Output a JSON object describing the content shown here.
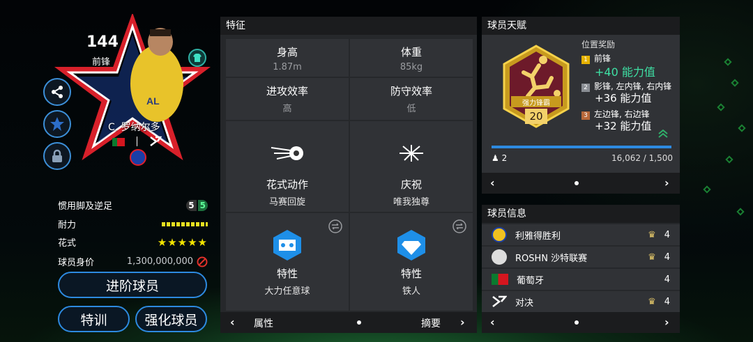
{
  "player": {
    "rating": "144",
    "position": "前锋",
    "name": "C. 罗纳尔多"
  },
  "left_stats": [
    {
      "label": "惯用脚及逆足",
      "value_a": "5",
      "value_b": "5"
    },
    {
      "label": "耐力"
    },
    {
      "label": "花式",
      "stars": "★★★★★"
    },
    {
      "label": "球员身价",
      "value": "1,300,000,000"
    }
  ],
  "buttons": {
    "advance": "进阶球员",
    "train": "特训",
    "enhance": "强化球员"
  },
  "traits": {
    "title": "特征",
    "height_label": "身高",
    "height_value": "1.87m",
    "weight_label": "体重",
    "weight_value": "85kg",
    "atk_label": "进攻效率",
    "atk_value": "高",
    "def_label": "防守效率",
    "def_value": "低",
    "skill_label": "花式动作",
    "skill_value": "马赛回旋",
    "celebration_label": "庆祝",
    "celebration_value": "唯我独尊",
    "trait1_label": "特性",
    "trait1_value": "大力任意球",
    "trait2_label": "特性",
    "trait2_value": "铁人",
    "nav_left": "属性",
    "nav_right": "摘要"
  },
  "talent": {
    "title": "球员天赋",
    "badge_name": "强力锋霸",
    "badge_level": "20",
    "bonus_title": "位置奖励",
    "bonuses": [
      {
        "rank": "1",
        "positions": "前锋",
        "value": "+40 能力值"
      },
      {
        "rank": "2",
        "positions": "影锋, 左内锋, 右内锋",
        "value": "+36 能力值"
      },
      {
        "rank": "3",
        "positions": "左边锋, 右边锋",
        "value": "+32 能力值"
      }
    ],
    "count": "2",
    "progress": "16,062 / 1,500"
  },
  "info": {
    "title": "球员信息",
    "rows": [
      {
        "label": "利雅得胜利",
        "value": "4"
      },
      {
        "label": "ROSHN 沙特联赛",
        "value": "4"
      },
      {
        "label": "葡萄牙",
        "value": "4"
      },
      {
        "label": "对决",
        "value": "4"
      }
    ]
  },
  "colors": {
    "accent": "#2d8ae0",
    "green": "#3ee0a4",
    "gold": "#e6b200"
  }
}
